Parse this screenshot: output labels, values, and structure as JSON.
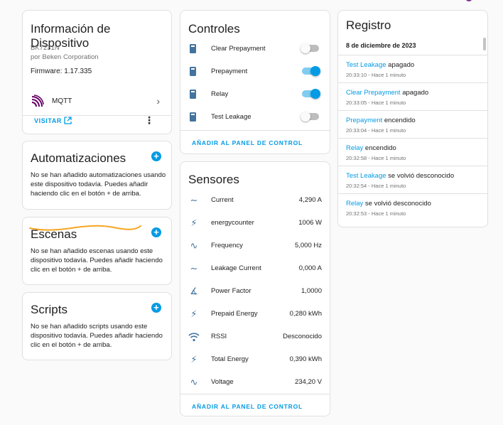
{
  "device": {
    "title": "Información de Dispositivo",
    "model": "BK7231N",
    "manufacturer": "por Beken Corporation",
    "firmware": "Firmware: 1.17.335",
    "integration": "MQTT",
    "visit_label": "VISITAR"
  },
  "automations": {
    "title": "Automatizaciones",
    "description": "No se han añadido automatizaciones usando este dispositivo todavía. Puedes añadir haciendo clic en el botón + de arriba."
  },
  "scenes": {
    "title": "Escenas",
    "description": "No se han añadido escenas usando este dispositivo todavía. Puedes añadir haciendo clic en el botón + de arriba."
  },
  "scripts": {
    "title": "Scripts",
    "description": "No se han añadido scripts usando este dispositivo todavía. Puedes añadir haciendo clic en el botón + de arriba."
  },
  "controls": {
    "title": "Controles",
    "items": [
      {
        "label": "Clear Prepayment",
        "on": false
      },
      {
        "label": "Prepayment",
        "on": true
      },
      {
        "label": "Relay",
        "on": true
      },
      {
        "label": "Test Leakage",
        "on": false
      }
    ],
    "action_label": "AÑADIR AL PANEL DE CONTROL"
  },
  "sensors": {
    "title": "Sensores",
    "items": [
      {
        "icon": "current-ac-icon",
        "label": "Current",
        "value": "4,290 A"
      },
      {
        "icon": "flash-icon",
        "label": "energycounter",
        "value": "1006 W"
      },
      {
        "icon": "sine-wave-icon",
        "label": "Frequency",
        "value": "5,000 Hz"
      },
      {
        "icon": "current-ac-icon",
        "label": "Leakage Current",
        "value": "0,000 A"
      },
      {
        "icon": "angle-icon",
        "label": "Power Factor",
        "value": "1,0000"
      },
      {
        "icon": "flash-icon",
        "label": "Prepaid Energy",
        "value": "0,280 kWh"
      },
      {
        "icon": "wifi-icon",
        "label": "RSSI",
        "value": "Desconocido"
      },
      {
        "icon": "flash-icon",
        "label": "Total Energy",
        "value": "0,390 kWh"
      },
      {
        "icon": "sine-wave-icon",
        "label": "Voltage",
        "value": "234,20 V"
      }
    ],
    "action_label": "AÑADIR AL PANEL DE CONTROL"
  },
  "log": {
    "title": "Registro",
    "date": "8 de diciembre de 2023",
    "entries": [
      {
        "entity": "Test Leakage",
        "state": " apagado",
        "time": "20:33:10 - Hace 1 minuto"
      },
      {
        "entity": "Clear Prepayment",
        "state": " apagado",
        "time": "20:33:05 - Hace 1 minuto"
      },
      {
        "entity": "Prepayment",
        "state": " encendido",
        "time": "20:33:04 - Hace 1 minuto"
      },
      {
        "entity": "Relay",
        "state": " encendido",
        "time": "20:32:58 - Hace 1 minuto"
      },
      {
        "entity": "Test Leakage",
        "state": " se volvió desconocido",
        "time": "20:32:54 - Hace 1 minuto"
      },
      {
        "entity": "Relay",
        "state": " se volvió desconocido",
        "time": "20:32:53 - Hace 1 minuto"
      }
    ]
  },
  "colors": {
    "accent": "#039be5",
    "icon": "#44739e",
    "highlight": "#f5a623"
  }
}
